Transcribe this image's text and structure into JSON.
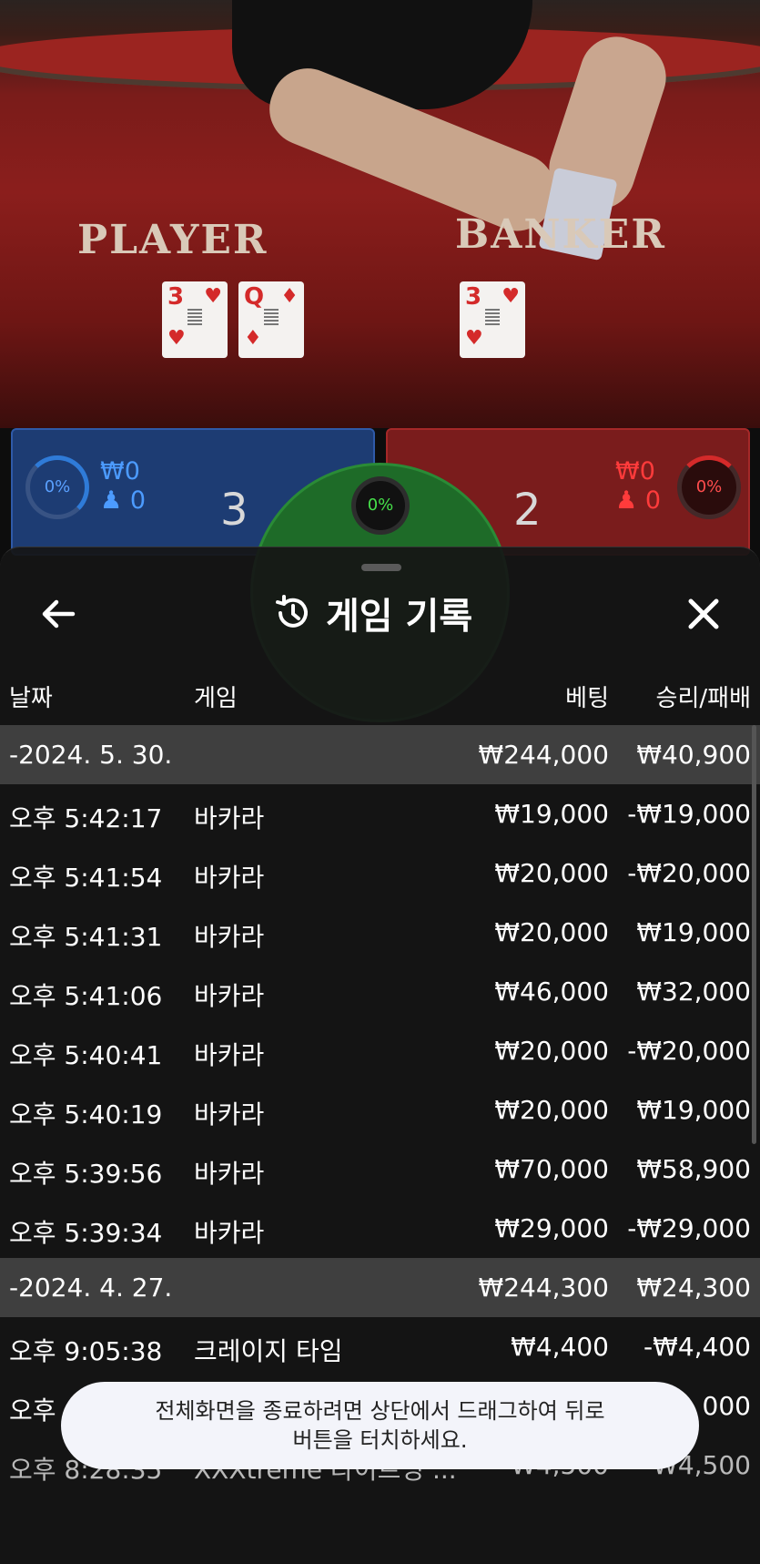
{
  "video": {
    "player_label": "PLAYER",
    "banker_label": "BANKER",
    "player_cards": [
      {
        "rank": "3",
        "suit": "♥"
      },
      {
        "rank": "Q",
        "suit": "♦"
      }
    ],
    "banker_cards": [
      {
        "rank": "3",
        "suit": "♥"
      }
    ]
  },
  "bet_area": {
    "player": {
      "percent": "0%",
      "amount": "₩0",
      "players": "0",
      "score": "3"
    },
    "tie": {
      "percent": "0%"
    },
    "banker": {
      "percent": "0%",
      "amount": "₩0",
      "players": "0",
      "score": "2"
    }
  },
  "history": {
    "title": "게임 기록",
    "columns": {
      "date": "날짜",
      "game": "게임",
      "bet": "베팅",
      "result": "승리/패배"
    },
    "groups": [
      {
        "date": "-2024. 5. 30.",
        "total_bet": "₩244,000",
        "total_result": "₩40,900",
        "rows": [
          {
            "time": "오후 5:42:17",
            "game": "바카라",
            "bet": "₩19,000",
            "result": "-₩19,000"
          },
          {
            "time": "오후 5:41:54",
            "game": "바카라",
            "bet": "₩20,000",
            "result": "-₩20,000"
          },
          {
            "time": "오후 5:41:31",
            "game": "바카라",
            "bet": "₩20,000",
            "result": "₩19,000"
          },
          {
            "time": "오후 5:41:06",
            "game": "바카라",
            "bet": "₩46,000",
            "result": "₩32,000"
          },
          {
            "time": "오후 5:40:41",
            "game": "바카라",
            "bet": "₩20,000",
            "result": "-₩20,000"
          },
          {
            "time": "오후 5:40:19",
            "game": "바카라",
            "bet": "₩20,000",
            "result": "₩19,000"
          },
          {
            "time": "오후 5:39:56",
            "game": "바카라",
            "bet": "₩70,000",
            "result": "₩58,900"
          },
          {
            "time": "오후 5:39:34",
            "game": "바카라",
            "bet": "₩29,000",
            "result": "-₩29,000"
          }
        ]
      },
      {
        "date": "-2024. 4. 27.",
        "total_bet": "₩244,300",
        "total_result": "₩24,300",
        "rows": [
          {
            "time": "오후 9:05:38",
            "game": "크레이지 타임",
            "bet": "₩4,400",
            "result": "-₩4,400"
          },
          {
            "time": "오후",
            "game": "",
            "bet": "",
            "result": "000"
          },
          {
            "time": "오후 8:28:35",
            "game": "XXXtreme 라이트닝 ...",
            "bet": "₩4,500",
            "result": "-₩4,500"
          }
        ]
      }
    ]
  },
  "toast": {
    "line1": "전체화면을 종료하려면 상단에서 드래그하여 뒤로",
    "line2": "버튼을 터치하세요."
  },
  "colors": {
    "player_blue": "#1d3c73",
    "banker_red": "#7a1c1c",
    "tie_green": "#1e6b28",
    "sheet_bg": "#161616",
    "date_row_bg": "#464646"
  }
}
